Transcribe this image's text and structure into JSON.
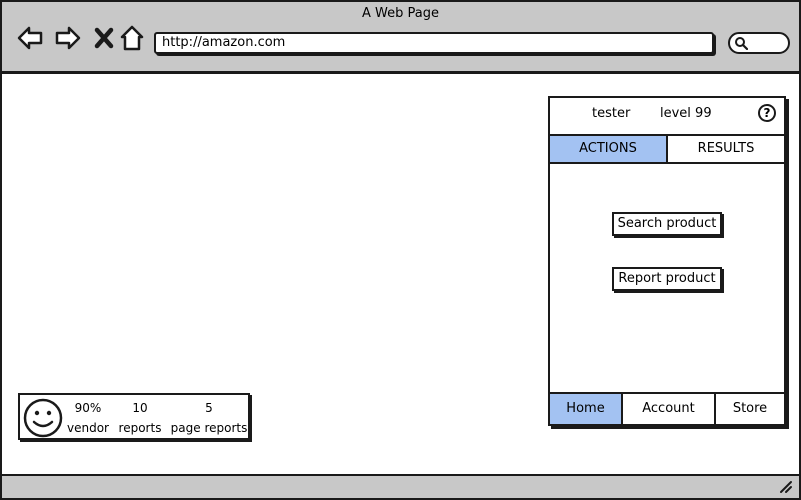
{
  "window": {
    "title": "A Web Page"
  },
  "browser": {
    "url": "http://amazon.com",
    "icons": [
      "back-arrow-icon",
      "forward-arrow-icon",
      "close-icon",
      "home-icon",
      "search-icon"
    ]
  },
  "panel": {
    "username": "tester",
    "level": "level 99",
    "help_icon": "?",
    "tabs": [
      {
        "label": "ACTIONS",
        "active": true
      },
      {
        "label": "RESULTS",
        "active": false
      }
    ],
    "actions": {
      "search_label": "Search product",
      "report_label": "Report product"
    },
    "bottom_nav": [
      {
        "label": "Home",
        "active": true
      },
      {
        "label": "Account",
        "active": false
      },
      {
        "label": "Store",
        "active": false
      }
    ]
  },
  "stats": {
    "icon": "smiley-icon",
    "items": [
      {
        "value": "90%",
        "label": "vendor"
      },
      {
        "value": "10",
        "label": "reports"
      },
      {
        "value": "5",
        "label": "page reports"
      }
    ]
  },
  "colors": {
    "accent": "#a3c2f2",
    "chrome": "#c8c8c8"
  }
}
